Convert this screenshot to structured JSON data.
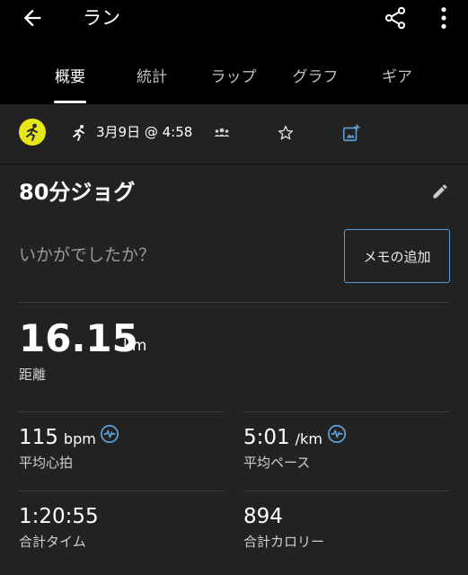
{
  "header": {
    "title": "ラン"
  },
  "tabs": [
    {
      "label": "概要",
      "active": true
    },
    {
      "label": "統計",
      "active": false
    },
    {
      "label": "ラップ",
      "active": false
    },
    {
      "label": "グラフ",
      "active": false
    },
    {
      "label": "ギア",
      "active": false
    }
  ],
  "activity": {
    "date": "3月9日 @ 4:58",
    "name": "80分ジョグ",
    "prompt": "いかがでしたか？",
    "memo_button": "メモの追加"
  },
  "distance": {
    "value": "16.15",
    "unit": "km",
    "label": "距離"
  },
  "stats": {
    "avg_hr": {
      "value": "115",
      "unit": "bpm",
      "label": "平均心拍"
    },
    "avg_pace": {
      "value": "5:01",
      "unit": "/km",
      "label": "平均ペース"
    },
    "total_time": {
      "value": "1:20:55",
      "label": "合計タイム"
    },
    "calories": {
      "value": "894",
      "label": "合計カロリー"
    }
  },
  "colors": {
    "accent": "#5b9bd5",
    "sport_badge": "#e6e61a",
    "background": "#222222",
    "appbar": "#000000"
  },
  "icons": [
    "back-arrow-icon",
    "share-icon",
    "more-vert-icon",
    "running-icon",
    "people-icon",
    "star-icon",
    "add-photo-icon",
    "edit-pencil-icon",
    "heart-rate-icon"
  ]
}
